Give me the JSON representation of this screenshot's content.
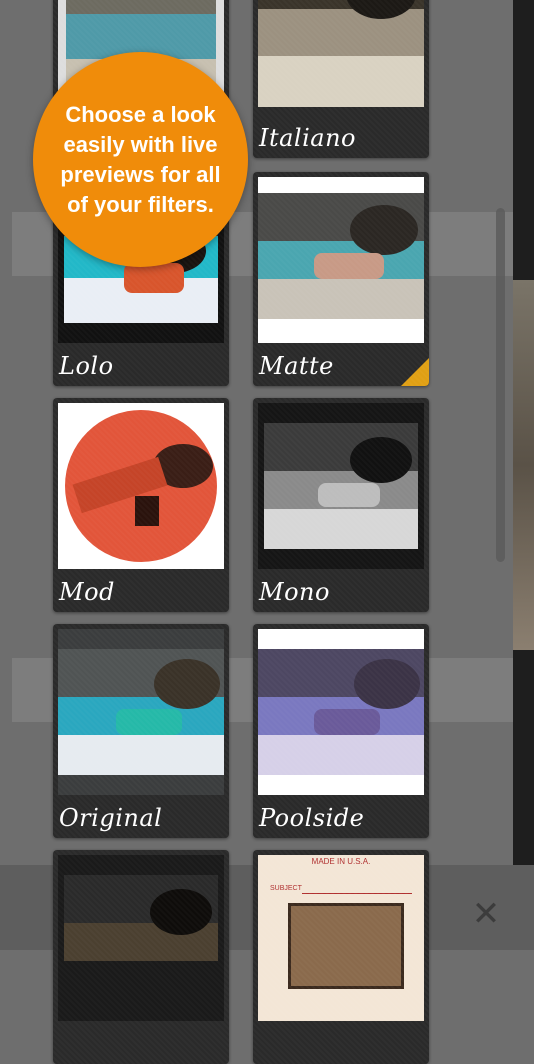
{
  "callout": {
    "text": "Choose a look easily with live previews for all of your filters."
  },
  "filters": [
    {
      "name": "",
      "style": "frame"
    },
    {
      "name": "Italiano",
      "style": "sepia"
    },
    {
      "name": "Lolo",
      "style": "vivid"
    },
    {
      "name": "Matte",
      "style": "matte",
      "selected": true
    },
    {
      "name": "Mod",
      "style": "mod-circle"
    },
    {
      "name": "Mono",
      "style": "mono"
    },
    {
      "name": "Original",
      "style": "original"
    },
    {
      "name": "Poolside",
      "style": "poolside"
    },
    {
      "name": "",
      "style": "dark"
    },
    {
      "name": "",
      "style": "postcard"
    }
  ],
  "postcard": {
    "made_in": "MADE IN U.S.A.",
    "subject": "SUBJECT"
  },
  "icons": {
    "close": "close-icon",
    "selected_marker": "selected-corner-icon"
  },
  "colors": {
    "accent": "#f08c0a",
    "selected": "#e0a014"
  }
}
